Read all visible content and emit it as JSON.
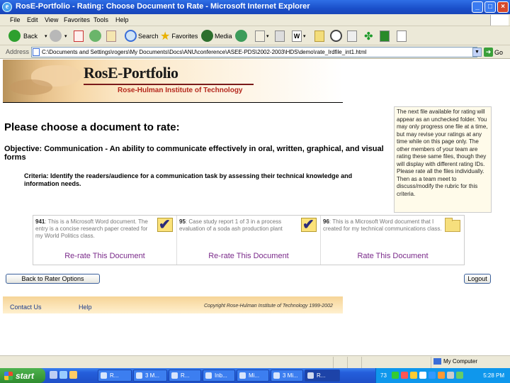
{
  "window": {
    "title": "RosE-Portfolio - Rating: Choose Document to Rate - Microsoft Internet Explorer"
  },
  "menu": [
    "File",
    "Edit",
    "View",
    "Favorites",
    "Tools",
    "Help"
  ],
  "toolbar": {
    "back": "Back",
    "search": "Search",
    "favorites": "Favorites",
    "media": "Media"
  },
  "address": {
    "label": "Address",
    "url": "C:\\Documents and Settings\\rogers\\My Documents\\Docs\\ANU\\conference\\ASEE-PDS\\2002-2003\\HDS\\demo\\rate_Irdfile_int1.html",
    "go": "Go"
  },
  "banner": {
    "brand": "RosE-Portfolio",
    "institute": "Rose-Hulman Institute of Technology"
  },
  "main": {
    "heading": "Please choose a document to rate:",
    "objective": "Objective: Communication - An ability to communicate effectively in oral, written, graphical, and visual forms",
    "criteria": "Criteria:  Identify the readers/audience for a communication task by assessing their technical knowledge and information needs."
  },
  "sidenote": "The next file available for rating will appear as an unchecked folder. You may only progress one file at a time, but may revise your ratings at any time while on this page only. The other members of your team are rating these same files, though they will display with different rating IDs. Please rate all the files individually. Then as a team meet to discuss/modify the rubric for this criteria.",
  "documents": [
    {
      "id": "941",
      "text": "This is a Microsoft Word document. The entry is a concise research paper created for my World Politics class.",
      "action": "Re-rate This Document",
      "status": "checked"
    },
    {
      "id": "95",
      "text": "Case study report 1 of 3 in a process evaluation of a soda ash production plant",
      "action": "Re-rate This Document",
      "status": "checked"
    },
    {
      "id": "96",
      "text": "This is a Microsoft Word document that I created for my technical communications class.",
      "action": "Rate This Document",
      "status": "folder"
    }
  ],
  "buttons": {
    "back_to_rater": "Back to Rater Options",
    "logout": "Logout"
  },
  "footer": {
    "contact": "Contact Us",
    "help": "Help",
    "copyright": "Copyright Rose-Hulman Institute of Technology 1999-2002"
  },
  "statusbar": {
    "zone": "My Computer"
  },
  "taskbar": {
    "start": "start",
    "tasks": [
      "R...",
      "3 M...",
      "R...",
      "Inb...",
      "Mi...",
      "3 Mi...",
      "R..."
    ],
    "tray_num": "73",
    "clock": "5:28 PM"
  },
  "colors": {
    "title_blue": "#1a4fc9",
    "institute_red": "#b5281d",
    "rate_link": "#7a2a8a",
    "footer_band": "#f6d497"
  }
}
